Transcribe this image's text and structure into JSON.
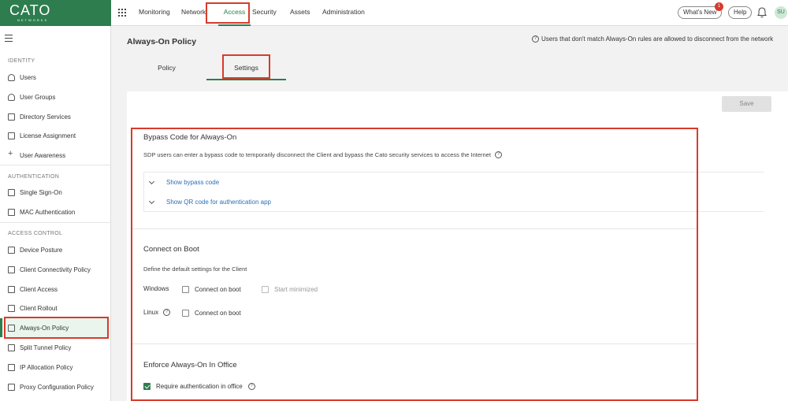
{
  "brand": {
    "name": "CATO",
    "sub": "NETWORKS"
  },
  "topnav": {
    "items": [
      "Monitoring",
      "Network",
      "Access",
      "Security",
      "Assets",
      "Administration"
    ],
    "active": "Access",
    "whats_new": "What's New",
    "whats_new_count": "1",
    "help": "Help",
    "avatar": "SU"
  },
  "sidebar": {
    "sections": [
      {
        "title": "IDENTITY",
        "items": [
          "Users",
          "User Groups",
          "Directory Services",
          "License Assignment",
          "User Awareness"
        ]
      },
      {
        "title": "AUTHENTICATION",
        "items": [
          "Single Sign-On",
          "MAC Authentication"
        ]
      },
      {
        "title": "ACCESS CONTROL",
        "items": [
          "Device Posture",
          "Client Connectivity Policy",
          "Client Access",
          "Client Rollout",
          "Always-On Policy",
          "Split Tunnel Policy",
          "IP Allocation Policy",
          "Proxy Configuration Policy"
        ]
      }
    ],
    "active": "Always-On Policy"
  },
  "page": {
    "title": "Always-On Policy",
    "info_note": "Users that don't match Always-On rules are allowed to disconnect from the network",
    "tabs": [
      "Policy",
      "Settings"
    ],
    "active_tab": "Settings",
    "save_label": "Save"
  },
  "bypass": {
    "title": "Bypass Code for Always-On",
    "description": "SDP users can enter a bypass code to temporarily disconnect the Client and bypass the Cato security services to access the Internet",
    "rows": [
      "Show bypass code",
      "Show QR code for authentication app"
    ]
  },
  "boot": {
    "title": "Connect on Boot",
    "description": "Define the default settings for the Client",
    "windows_label": "Windows",
    "linux_label": "Linux",
    "connect_on_boot": "Connect on boot",
    "start_minimized": "Start minimized",
    "windows_connect_checked": false,
    "windows_minimized_checked": false,
    "linux_connect_checked": false
  },
  "office": {
    "title": "Enforce Always-On In Office",
    "require_auth": "Require authentication in office",
    "require_auth_checked": true
  },
  "colors": {
    "brand": "#2e7d4f",
    "highlight": "#d93a2b",
    "link": "#2b6fb8"
  }
}
